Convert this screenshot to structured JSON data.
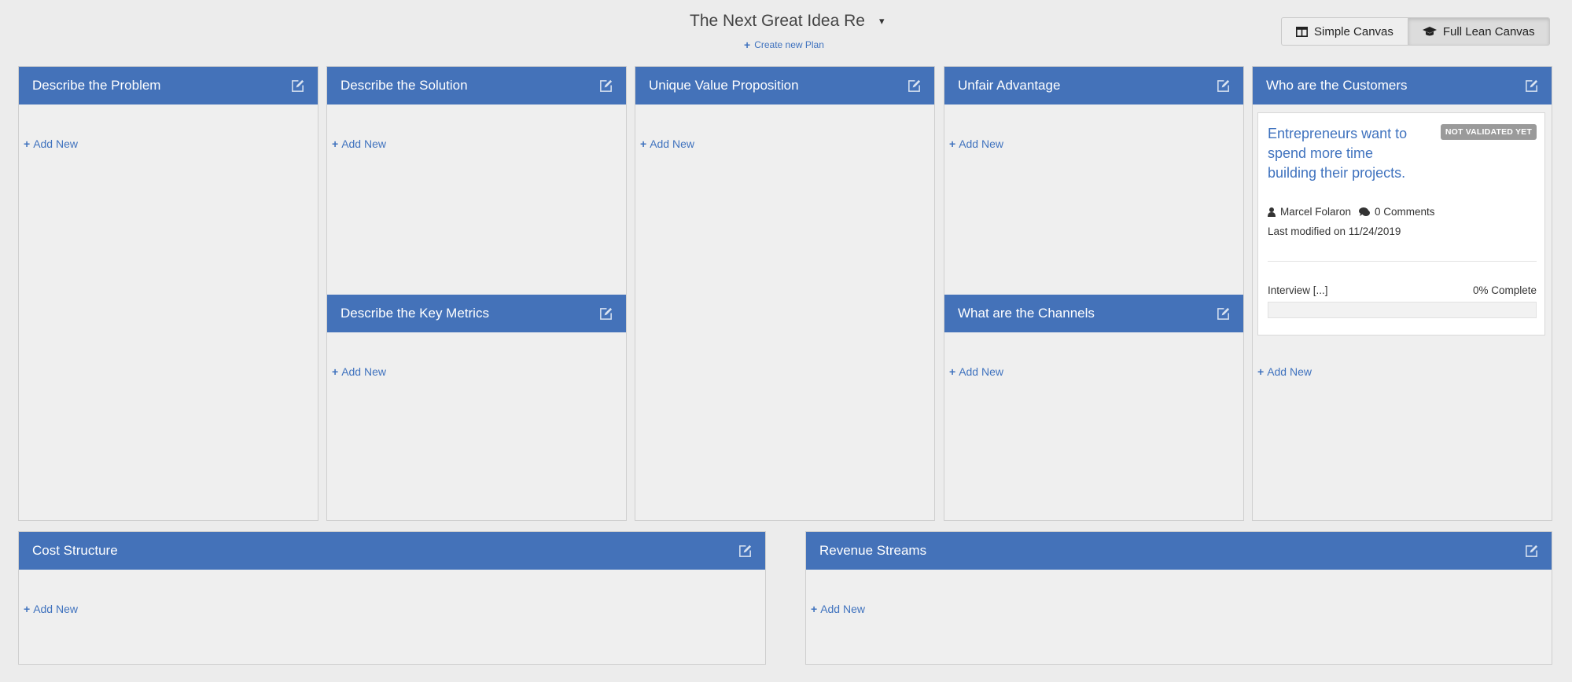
{
  "header": {
    "plan_title": "The Next Great Idea Re",
    "dropdown_caret": "▾",
    "create_plan_label": "Create new Plan",
    "simple_canvas_label": "Simple Canvas",
    "full_lean_canvas_label": "Full Lean Canvas"
  },
  "icons": {
    "plus": "plus-icon",
    "edit": "edit-icon",
    "columns": "columns-icon",
    "graduation_cap": "graduation-cap-icon",
    "user": "user-icon",
    "comments": "comments-icon"
  },
  "colors": {
    "header_blue": "#4472b9",
    "link_blue": "#3f72be",
    "badge_gray": "#9a9a9a",
    "panel_bg": "#efefef"
  },
  "add_new_label": "Add New",
  "panels": {
    "problem": {
      "title": "Describe the Problem"
    },
    "solution": {
      "title": "Describe the Solution"
    },
    "key_metrics": {
      "title": "Describe the Key Metrics"
    },
    "uvp": {
      "title": "Unique Value Proposition"
    },
    "unfair_advantage": {
      "title": "Unfair Advantage"
    },
    "channels": {
      "title": "What are the Channels"
    },
    "customers": {
      "title": "Who are the Customers"
    },
    "cost_structure": {
      "title": "Cost Structure"
    },
    "revenue_streams": {
      "title": "Revenue Streams"
    }
  },
  "customer_card": {
    "badge": "NOT VALIDATED YET",
    "title": "Entrepreneurs want to spend more time building their projects.",
    "author": "Marcel Folaron",
    "comments": "0 Comments",
    "last_modified": "Last modified on 11/24/2019",
    "task_label": "Interview [...]",
    "progress_label": "0% Complete",
    "progress": 0
  }
}
